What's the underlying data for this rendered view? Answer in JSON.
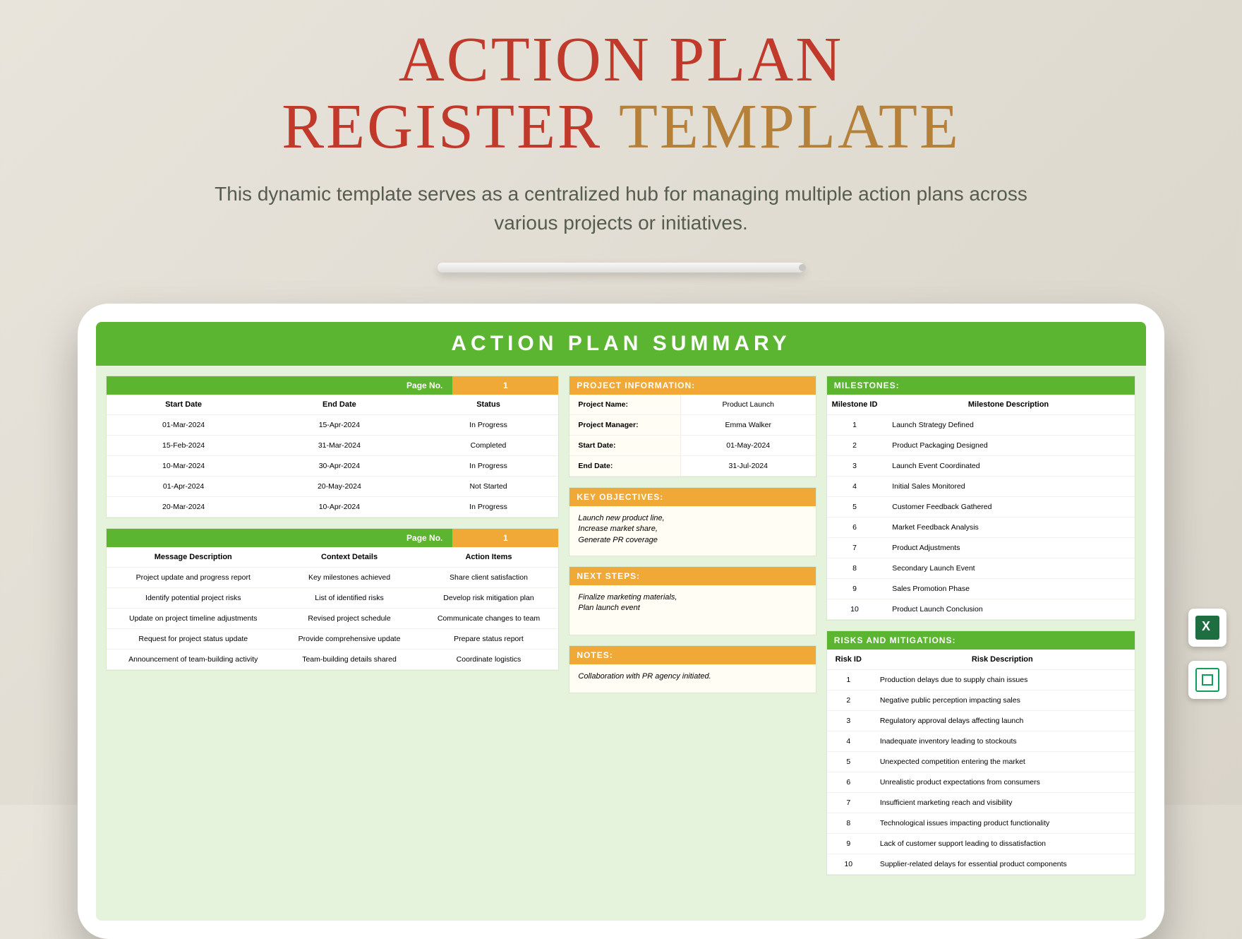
{
  "hero": {
    "line1a": "ACTION PLAN",
    "line2a": "REGISTER ",
    "line2b": "TEMPLATE",
    "subtitle": "This dynamic template serves as a centralized hub for managing multiple action plans across various projects or initiatives."
  },
  "banner": "ACTION PLAN SUMMARY",
  "page_label": "Page No.",
  "page_number": "1",
  "dates_table": {
    "headers": [
      "Start Date",
      "End Date",
      "Status"
    ],
    "rows": [
      [
        "01-Mar-2024",
        "15-Apr-2024",
        "In Progress"
      ],
      [
        "15-Feb-2024",
        "31-Mar-2024",
        "Completed"
      ],
      [
        "10-Mar-2024",
        "30-Apr-2024",
        "In Progress"
      ],
      [
        "01-Apr-2024",
        "20-May-2024",
        "Not Started"
      ],
      [
        "20-Mar-2024",
        "10-Apr-2024",
        "In Progress"
      ]
    ]
  },
  "msg_table": {
    "headers": [
      "Message Description",
      "Context Details",
      "Action Items"
    ],
    "rows": [
      [
        "Project update and progress report",
        "Key milestones achieved",
        "Share client satisfaction"
      ],
      [
        "Identify potential project risks",
        "List of identified risks",
        "Develop risk mitigation plan"
      ],
      [
        "Update on project timeline adjustments",
        "Revised project schedule",
        "Communicate changes to team"
      ],
      [
        "Request for project status update",
        "Provide comprehensive update",
        "Prepare status report"
      ],
      [
        "Announcement of team-building activity",
        "Team-building details shared",
        "Coordinate logistics"
      ]
    ]
  },
  "project_info": {
    "title": "PROJECT INFORMATION:",
    "rows": [
      [
        "Project Name:",
        "Product Launch"
      ],
      [
        "Project Manager:",
        "Emma Walker"
      ],
      [
        "Start Date:",
        "01-May-2024"
      ],
      [
        "End Date:",
        "31-Jul-2024"
      ]
    ]
  },
  "key_objectives": {
    "title": "KEY OBJECTIVES:",
    "body": "Launch new product line,\nIncrease market share,\nGenerate PR coverage"
  },
  "next_steps": {
    "title": "NEXT STEPS:",
    "body": "Finalize marketing materials,\nPlan launch event"
  },
  "notes": {
    "title": "NOTES:",
    "body": "Collaboration with PR agency initiated."
  },
  "milestones": {
    "title": "MILESTONES:",
    "headers": [
      "Milestone ID",
      "Milestone Description"
    ],
    "rows": [
      [
        "1",
        "Launch Strategy Defined"
      ],
      [
        "2",
        "Product Packaging Designed"
      ],
      [
        "3",
        "Launch Event Coordinated"
      ],
      [
        "4",
        "Initial Sales Monitored"
      ],
      [
        "5",
        "Customer Feedback Gathered"
      ],
      [
        "6",
        "Market Feedback Analysis"
      ],
      [
        "7",
        "Product Adjustments"
      ],
      [
        "8",
        "Secondary Launch Event"
      ],
      [
        "9",
        "Sales Promotion Phase"
      ],
      [
        "10",
        "Product Launch Conclusion"
      ]
    ]
  },
  "risks": {
    "title": "RISKS AND MITIGATIONS:",
    "headers": [
      "Risk ID",
      "Risk Description"
    ],
    "rows": [
      [
        "1",
        "Production delays due to supply chain issues"
      ],
      [
        "2",
        "Negative public perception impacting sales"
      ],
      [
        "3",
        "Regulatory approval delays affecting launch"
      ],
      [
        "4",
        "Inadequate inventory leading to stockouts"
      ],
      [
        "5",
        "Unexpected competition entering the market"
      ],
      [
        "6",
        "Unrealistic product expectations from consumers"
      ],
      [
        "7",
        "Insufficient marketing reach and visibility"
      ],
      [
        "8",
        "Technological issues impacting product functionality"
      ],
      [
        "9",
        "Lack of customer support leading to dissatisfaction"
      ],
      [
        "10",
        "Supplier-related delays for essential product components"
      ]
    ]
  }
}
